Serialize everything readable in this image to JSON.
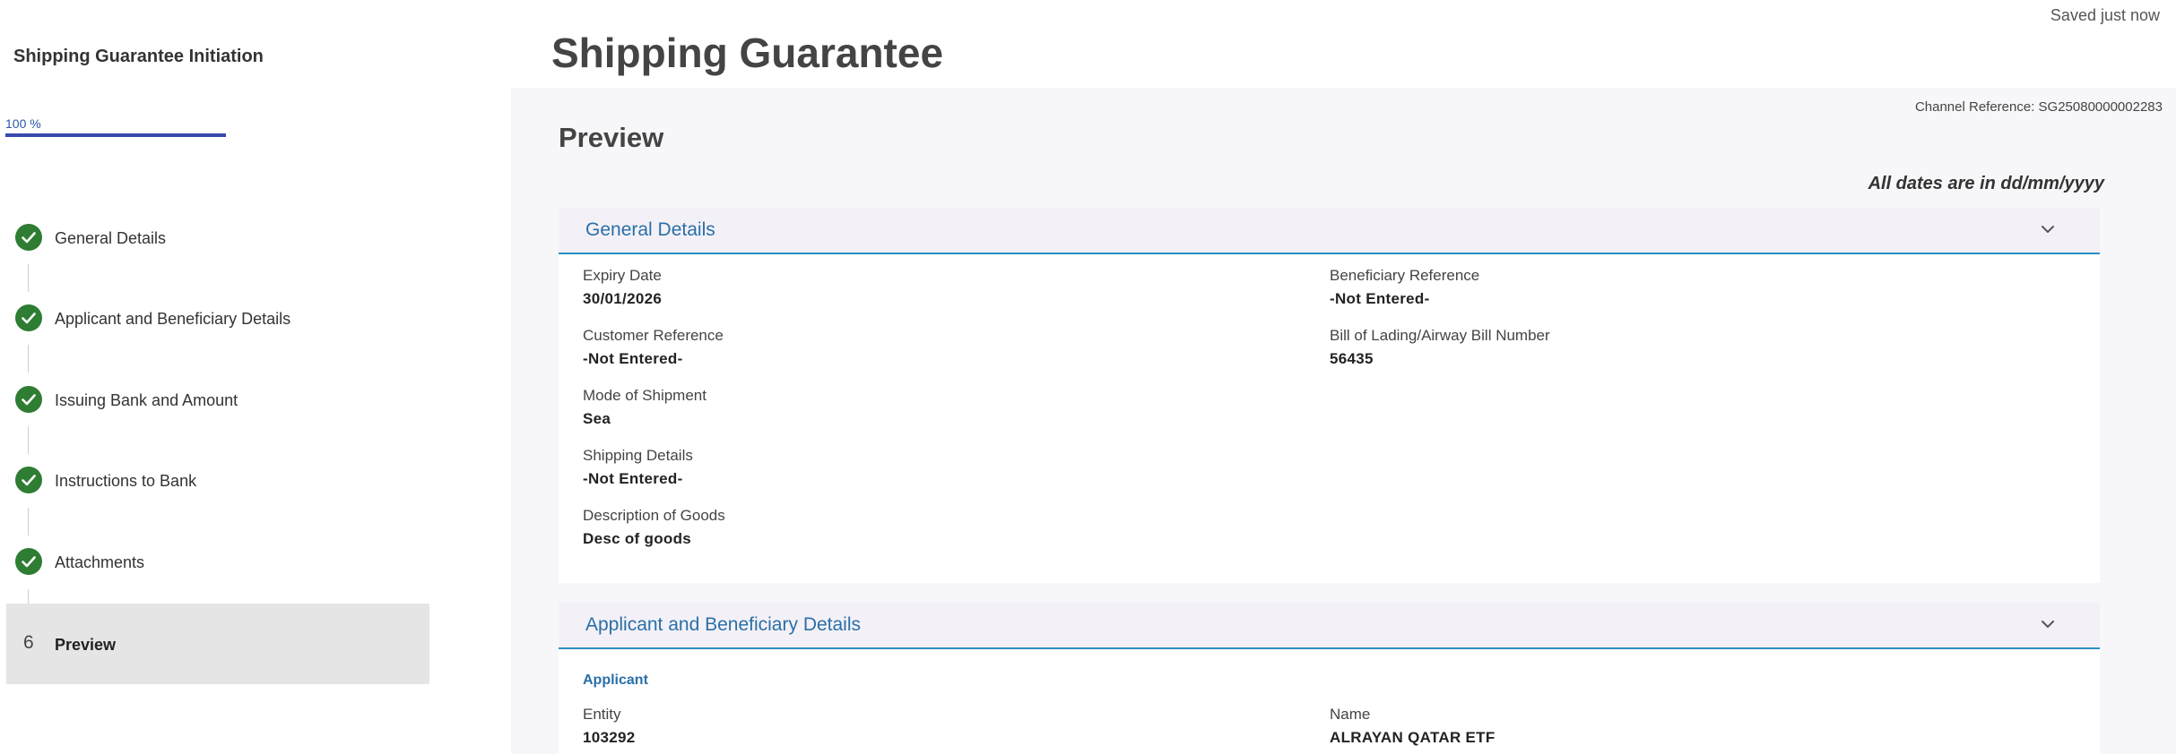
{
  "header": {
    "title": "Shipping Guarantee",
    "saved_status": "Saved just now"
  },
  "sidebar": {
    "title": "Shipping Guarantee Initiation",
    "progress_label": "100 %",
    "progress_value": 100,
    "steps": [
      {
        "label": "General Details",
        "status": "complete"
      },
      {
        "label": "Applicant and Beneficiary Details",
        "status": "complete"
      },
      {
        "label": "Issuing Bank and Amount",
        "status": "complete"
      },
      {
        "label": "Instructions to Bank",
        "status": "complete"
      },
      {
        "label": "Attachments",
        "status": "complete"
      },
      {
        "label": "Preview",
        "status": "active",
        "number": "6"
      }
    ]
  },
  "main": {
    "channel_reference": "Channel Reference: SG25080000002283",
    "preview_title": "Preview",
    "dates_note": "All dates are in dd/mm/yyyy",
    "sections": [
      {
        "title": "General Details",
        "fields": [
          {
            "label": "Expiry Date",
            "value": "30/01/2026"
          },
          {
            "label": "Beneficiary Reference",
            "value": "-Not Entered-"
          },
          {
            "label": "Customer Reference",
            "value": "-Not Entered-"
          },
          {
            "label": "Bill of Lading/Airway Bill Number",
            "value": "56435"
          },
          {
            "label": "Mode of Shipment",
            "value": "Sea"
          },
          {
            "label": "Shipping Details",
            "value": "-Not Entered-"
          },
          {
            "label": "Description of Goods",
            "value": "Desc of goods"
          }
        ]
      },
      {
        "title": "Applicant and Beneficiary Details",
        "subheading": "Applicant",
        "fields": [
          {
            "label": "Entity",
            "value": "103292"
          },
          {
            "label": "Name",
            "value": "ALRAYAN QATAR ETF"
          }
        ]
      }
    ]
  },
  "colors": {
    "accent_blue": "#2a6fa8",
    "section_rule": "#2b8fc4",
    "progress_fill": "#3949ab",
    "step_complete": "#2e7d32"
  },
  "icons": {
    "step_complete": "check-circle-icon",
    "section_toggle": "chevron-down-icon"
  }
}
